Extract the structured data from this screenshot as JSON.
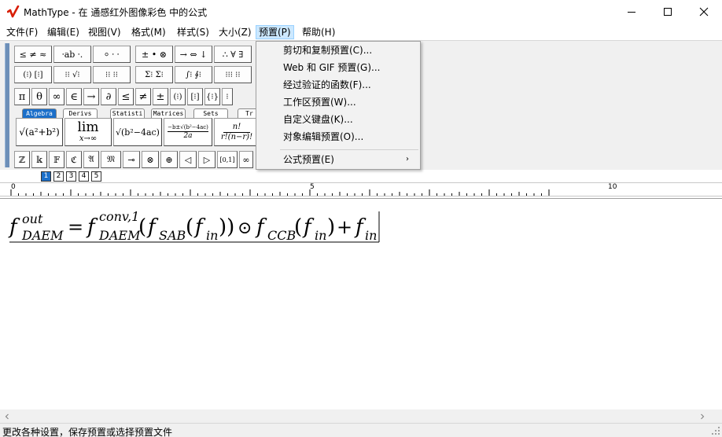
{
  "window": {
    "title": "MathType - 在 通感红外图像彩色 中的公式",
    "accent_color": "#d81e06"
  },
  "menubar": {
    "items": [
      "文件(F)",
      "编辑(E)",
      "视图(V)",
      "格式(M)",
      "样式(S)",
      "大小(Z)",
      "预置(P)",
      "帮助(H)"
    ],
    "active_index": 6,
    "active_bg": "#cce8ff"
  },
  "toolbar": {
    "row1": [
      "≤ ≠ ≈",
      "⸱ab ⸱.",
      "⸰ ⸱ ⸱",
      "± • ⊗",
      "→ ⇔ ↓",
      "∴ ∀ ∃"
    ],
    "row2": [
      "(⁝) [⁝]",
      "⁝⁝ √⁝",
      "⁝⁝ ⁝⁝",
      "Σ⁝ Σ⁝",
      "∫⁝ ∮⁝",
      "⁝⁝⁝ ⁝⁝"
    ],
    "row3": [
      "π",
      "θ",
      "∞",
      "∈",
      "→",
      "∂",
      "≤",
      "≠",
      "±",
      "(⁝)",
      "[⁝]",
      "{⁝}",
      "⁝"
    ],
    "tabs": [
      "Algebra",
      "Derivs",
      "Statisti",
      "Matrices",
      "Sets",
      "Tr"
    ],
    "active_tab": 0,
    "templates": {
      "sqrt_sum": "√(a²+b²)",
      "lim_label": "lim",
      "lim_sub": "x→∞",
      "sqrt_disc": "√(b²−4ac)",
      "quad_num": "−b±√(b²−4ac)",
      "quad_den": "2a",
      "binom_num": "n!",
      "binom_den": "r!(n−r)!"
    },
    "row5": [
      "ℤ",
      "𝕜",
      "𝔽",
      "ℭ",
      "𝔄",
      "𝔐",
      "⊸",
      "⊗",
      "⊕",
      "◁",
      "▷",
      "[0,1]",
      "∞"
    ],
    "nav_buttons": [
      "1",
      "2",
      "3",
      "4",
      "5"
    ]
  },
  "ruler": {
    "labels": [
      "0",
      "5",
      "10"
    ]
  },
  "equation": {
    "lhs_base": "f",
    "lhs_sup": "out",
    "lhs_sub": "DAEM",
    "equals": "=",
    "conv_base": "f",
    "conv_sup": "conv,1",
    "conv_sub": "DAEM",
    "sab_base": "f",
    "sab_sub": "SAB",
    "in_base": "f",
    "in_sub": "in",
    "odot": "⊙",
    "ccb_base": "f",
    "ccb_sub": "CCB",
    "plus": "+"
  },
  "dropdown": {
    "items": [
      "剪切和复制预置(C)...",
      "Web 和 GIF 预置(G)...",
      "经过验证的函数(F)...",
      "工作区预置(W)...",
      "自定义键盘(K)...",
      "对象编辑预置(O)...",
      "公式预置(E)"
    ],
    "submenu_arrow": "›"
  },
  "statusbar": {
    "text": "更改各种设置，保存预置或选择预置文件"
  }
}
